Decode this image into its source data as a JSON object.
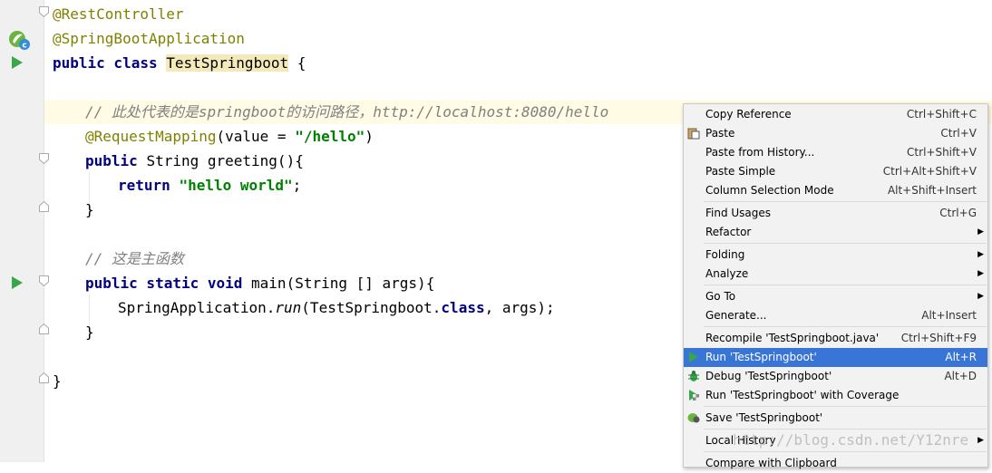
{
  "editor": {
    "lines": {
      "l1": {
        "anno": "@RestController"
      },
      "l2": {
        "anno": "@SpringBootApplication"
      },
      "l3": {
        "kw": "public class ",
        "cls": "TestSpringboot",
        "rest": " {"
      },
      "l5": {
        "comment": "// 此处代表的是springboot的访问路径，http://localhost:8080/hello"
      },
      "l6": {
        "anno": "@RequestMapping",
        "rest1": "(value = ",
        "str": "\"/hello\"",
        "rest2": ")"
      },
      "l7": {
        "kw": "public ",
        "rest": "String greeting(){"
      },
      "l8": {
        "kw": "return ",
        "str": "\"hello world\"",
        "rest": ";"
      },
      "l9": {
        "rest": "}"
      },
      "l11": {
        "comment": "// 这是主函数"
      },
      "l12": {
        "kw": "public static void ",
        "rest": "main(String [] args){"
      },
      "l13": {
        "rest1": "SpringApplication.",
        "it": "run",
        "rest2": "(TestSpringboot.",
        "kw": "class",
        "rest3": ", args);"
      },
      "l14": {
        "rest": "}"
      },
      "l16": {
        "rest": "}"
      }
    }
  },
  "context_menu": {
    "items": {
      "copy_reference": {
        "label": "Copy Reference",
        "shortcut": "Ctrl+Shift+C"
      },
      "paste": {
        "label": "Paste",
        "shortcut": "Ctrl+V"
      },
      "paste_history": {
        "label": "Paste from History...",
        "shortcut": "Ctrl+Shift+V"
      },
      "paste_simple": {
        "label": "Paste Simple",
        "shortcut": "Ctrl+Alt+Shift+V"
      },
      "column_selection": {
        "label": "Column Selection Mode",
        "shortcut": "Alt+Shift+Insert"
      },
      "find_usages": {
        "label": "Find Usages",
        "shortcut": "Ctrl+G"
      },
      "refactor": {
        "label": "Refactor"
      },
      "folding": {
        "label": "Folding"
      },
      "analyze": {
        "label": "Analyze"
      },
      "go_to": {
        "label": "Go To"
      },
      "generate": {
        "label": "Generate...",
        "shortcut": "Alt+Insert"
      },
      "recompile": {
        "label": "Recompile 'TestSpringboot.java'",
        "shortcut": "Ctrl+Shift+F9"
      },
      "run": {
        "label": "Run 'TestSpringboot'",
        "shortcut": "Alt+R"
      },
      "debug": {
        "label": "Debug 'TestSpringboot'",
        "shortcut": "Alt+D"
      },
      "coverage": {
        "label": "Run 'TestSpringboot' with Coverage"
      },
      "save": {
        "label": "Save 'TestSpringboot'"
      },
      "local_history": {
        "label": "Local History"
      },
      "compare_clipboard": {
        "label": "Compare with Clipboard"
      }
    }
  },
  "watermark": "http://blog.csdn.net/Y12nre",
  "colors": {
    "selection": "#3875d6",
    "annotation": "#808000",
    "keyword": "#000080",
    "string": "#008000",
    "comment": "#808080"
  }
}
